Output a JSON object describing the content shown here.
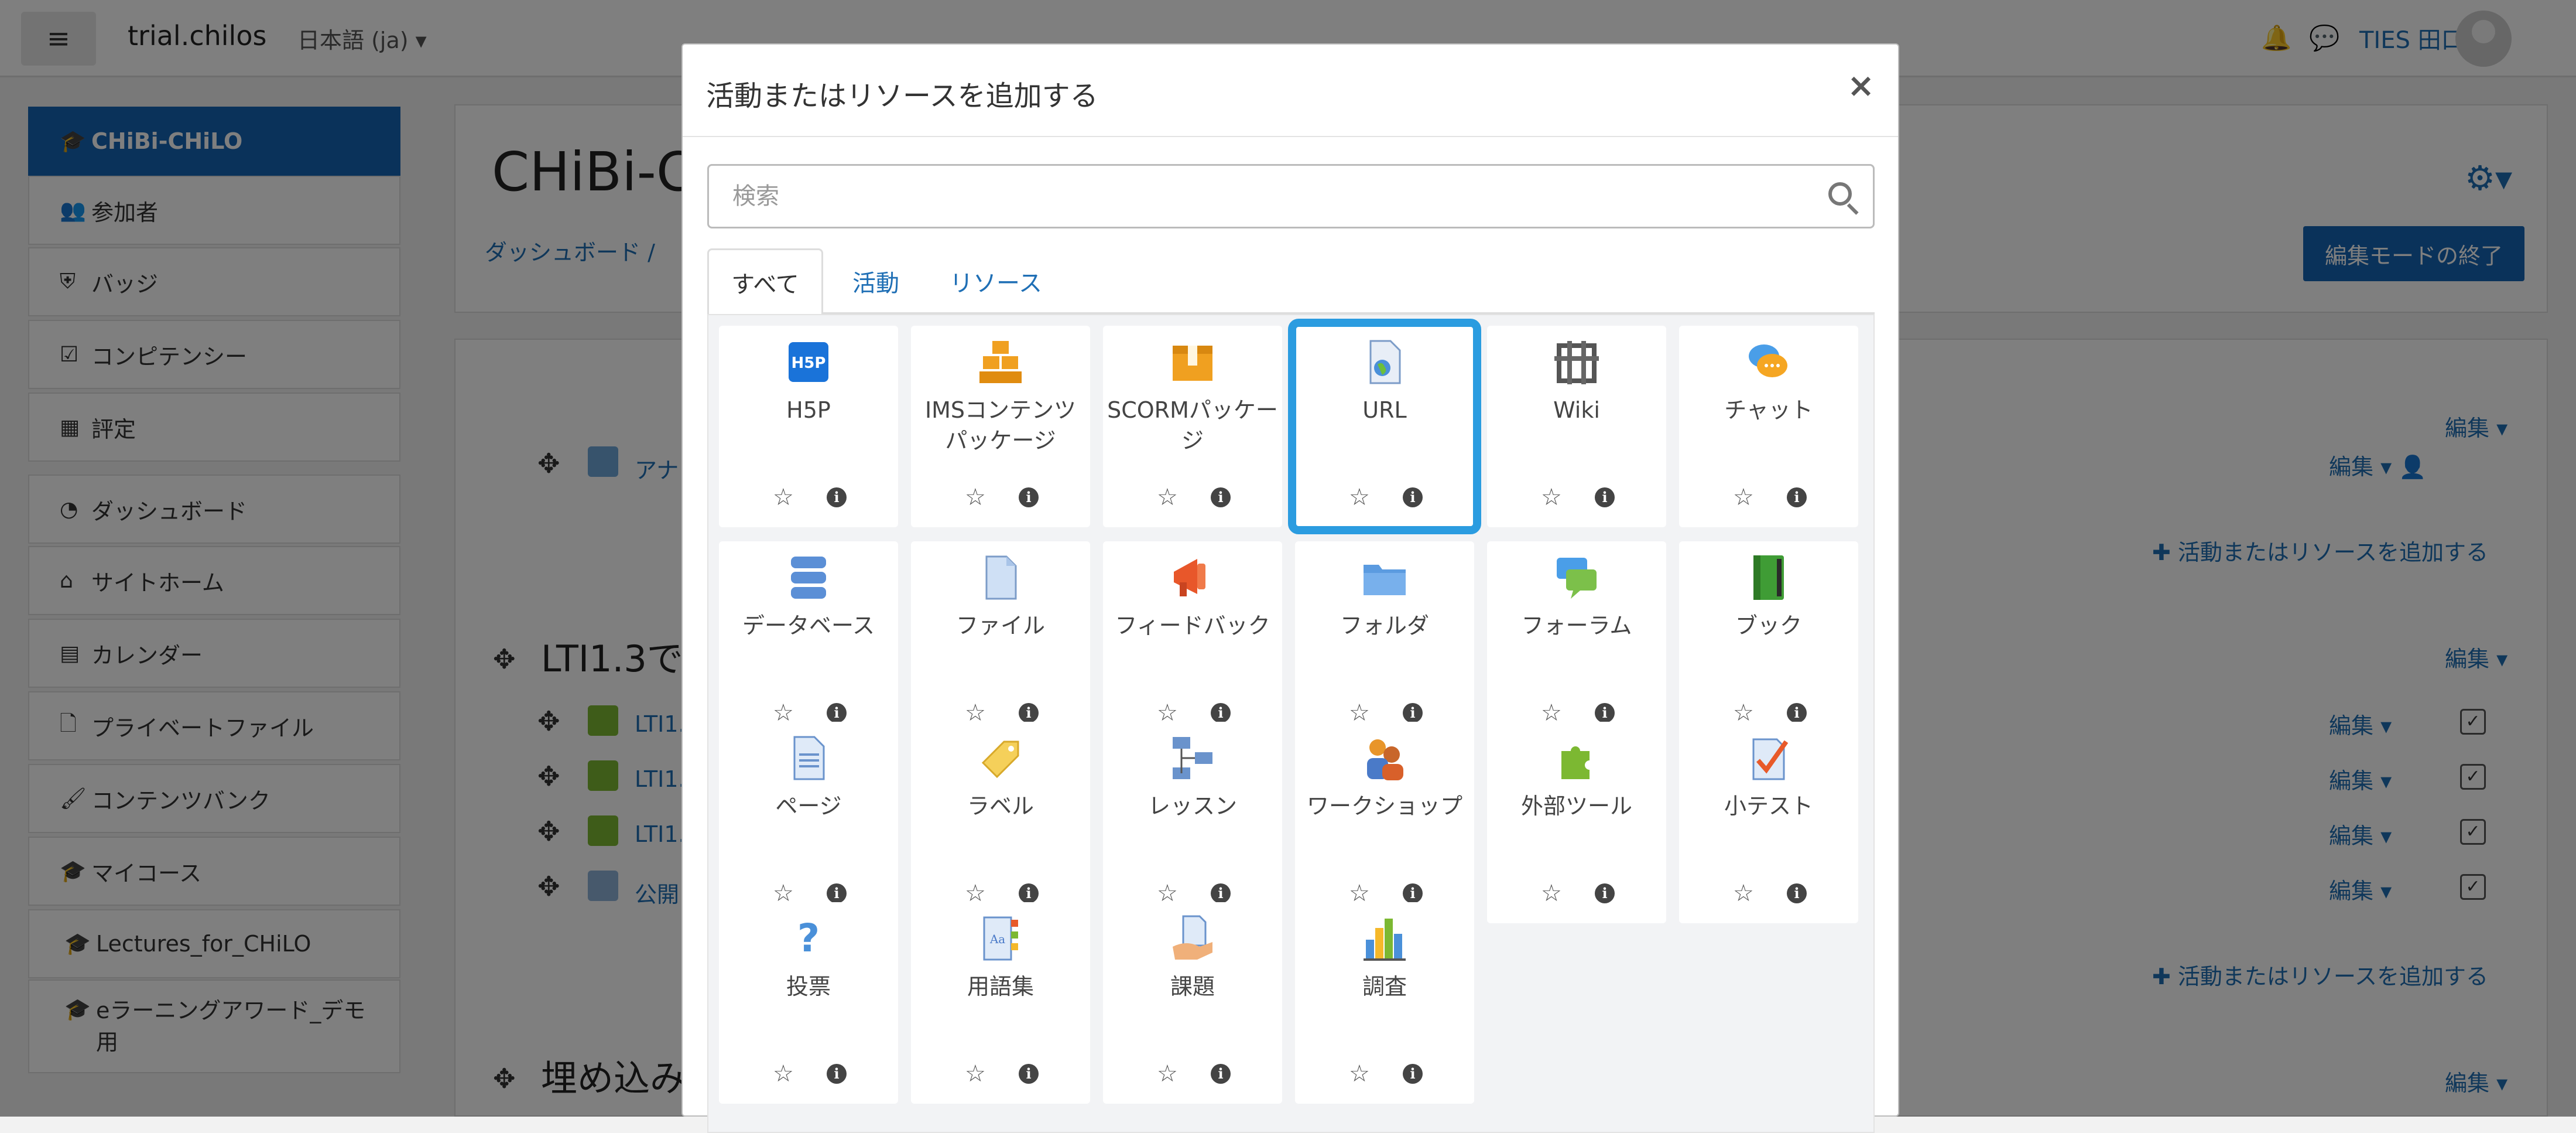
{
  "navbar": {
    "menu_icon": "hamburger-icon",
    "brand": "trial.chilos",
    "language": "日本語 (ja)",
    "user_name": "TIES 田口",
    "bell_icon": "bell-icon",
    "chat_icon": "chat-icon"
  },
  "sidebar": {
    "items": [
      {
        "label": "CHiBi-CHiLO",
        "icon": "graduation-cap-icon",
        "active": true
      },
      {
        "label": "参加者",
        "icon": "users-icon"
      },
      {
        "label": "バッジ",
        "icon": "shield-icon"
      },
      {
        "label": "コンピテンシー",
        "icon": "checkbox-icon"
      },
      {
        "label": "評定",
        "icon": "table-icon"
      },
      {
        "label": "ダッシュボード",
        "icon": "dashboard-icon"
      },
      {
        "label": "サイトホーム",
        "icon": "home-icon"
      },
      {
        "label": "カレンダー",
        "icon": "calendar-icon"
      },
      {
        "label": "プライベートファイル",
        "icon": "file-icon"
      },
      {
        "label": "コンテンツバンク",
        "icon": "brush-icon"
      },
      {
        "label": "マイコース",
        "icon": "graduation-cap-icon"
      },
      {
        "label": "Lectures_for_CHiLO",
        "icon": "graduation-cap-icon"
      },
      {
        "label": "eラーニングアワード_デモ用",
        "icon": "graduation-cap-icon"
      }
    ]
  },
  "main": {
    "course_title": "CHiBi-C",
    "breadcrumb": "ダッシュボード / ",
    "exit_edit_label": "編集モードの終了",
    "edit_label": "編集",
    "add_activity_label": "活動またはリソースを追加する",
    "section2_title": "LTI1.3で",
    "section3_title": "埋め込み",
    "activity_announce": "アナ",
    "activity_lti": "LTI1.",
    "activity_public": "公開"
  },
  "modal": {
    "title": "活動またはリソースを追加する",
    "close_label": "×",
    "search_placeholder": "検索",
    "tabs": [
      "すべて",
      "活動",
      "リソース"
    ],
    "active_tab": "すべて",
    "selected_item": "URL",
    "items": [
      {
        "label": "H5P",
        "icon": "h5p-icon"
      },
      {
        "label": "IMSコンテンツパッケージ",
        "icon": "ims-package-icon"
      },
      {
        "label": "SCORMパッケージ",
        "icon": "scorm-package-icon"
      },
      {
        "label": "URL",
        "icon": "url-icon"
      },
      {
        "label": "Wiki",
        "icon": "wiki-icon"
      },
      {
        "label": "チャット",
        "icon": "chat-icon"
      },
      {
        "label": "データベース",
        "icon": "database-icon"
      },
      {
        "label": "ファイル",
        "icon": "file-icon"
      },
      {
        "label": "フィードバック",
        "icon": "megaphone-icon"
      },
      {
        "label": "フォルダ",
        "icon": "folder-icon"
      },
      {
        "label": "フォーラム",
        "icon": "forum-icon"
      },
      {
        "label": "ブック",
        "icon": "book-icon"
      },
      {
        "label": "ページ",
        "icon": "page-icon"
      },
      {
        "label": "ラベル",
        "icon": "label-icon"
      },
      {
        "label": "レッスン",
        "icon": "lesson-icon"
      },
      {
        "label": "ワークショップ",
        "icon": "workshop-icon"
      },
      {
        "label": "外部ツール",
        "icon": "puzzle-icon"
      },
      {
        "label": "小テスト",
        "icon": "quiz-icon"
      },
      {
        "label": "投票",
        "icon": "question-icon"
      },
      {
        "label": "用語集",
        "icon": "glossary-icon"
      },
      {
        "label": "課題",
        "icon": "assignment-icon"
      },
      {
        "label": "調査",
        "icon": "survey-chart-icon"
      }
    ]
  },
  "colors": {
    "primary": "#1565b4",
    "link": "#1f6fb5",
    "selected_outline": "#2b9ce0"
  }
}
